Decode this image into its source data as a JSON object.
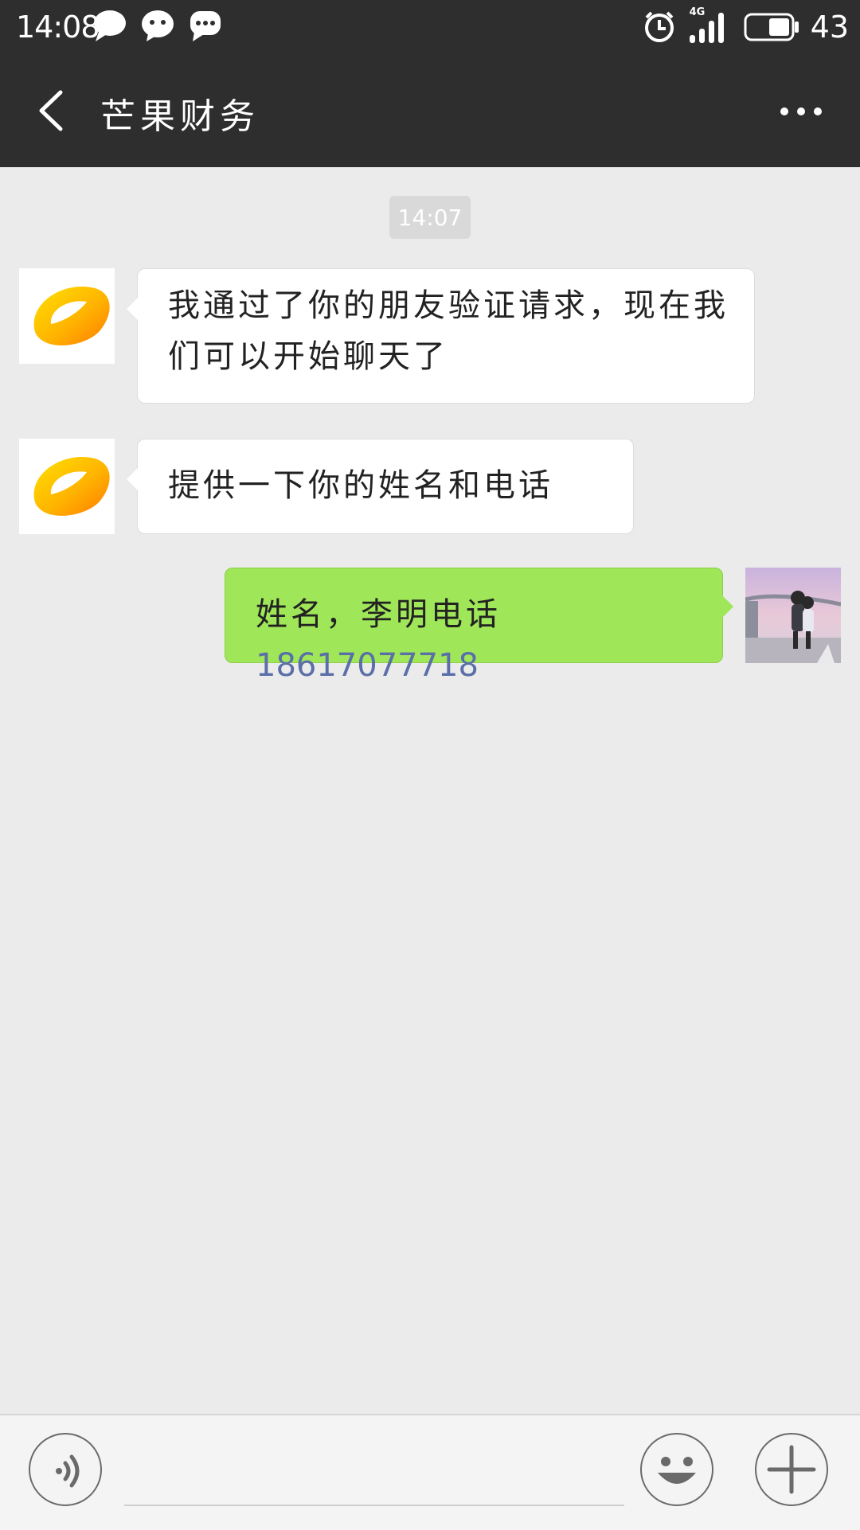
{
  "status_bar": {
    "time": "14:08",
    "notification_icons": [
      "chat-bubble-icon",
      "wechat-icon",
      "message-icon"
    ],
    "network": "4G",
    "battery_level": "43"
  },
  "header": {
    "title": "芒果财务",
    "back_icon": "chevron-left-icon",
    "more_icon": "more-dots-icon"
  },
  "chat": {
    "timestamp": "14:07",
    "messages": [
      {
        "direction": "incoming",
        "text": "我通过了你的朋友验证请求，现在我们可以开始聊天了"
      },
      {
        "direction": "incoming",
        "text": "提供一下你的姓名和电话"
      },
      {
        "direction": "outgoing",
        "text": "姓名，李明电话",
        "phone": "18617077718"
      }
    ]
  },
  "input_bar": {
    "voice_icon": "voice-icon",
    "input_placeholder": "",
    "emoji_icon": "emoji-icon",
    "plus_icon": "plus-icon"
  },
  "colors": {
    "header_bg": "#2e2e2e",
    "chat_bg": "#ebebeb",
    "outgoing_bubble": "#9fe658",
    "incoming_bubble": "#ffffff",
    "phone_link": "#5a6ea8"
  }
}
